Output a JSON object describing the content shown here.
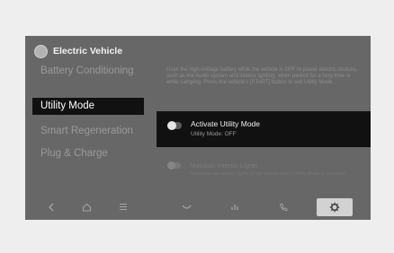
{
  "header": {
    "title": "Electric Vehicle"
  },
  "menu": {
    "items": [
      {
        "label": "Battery Conditioning"
      },
      {
        "label": "Utility Mode"
      },
      {
        "label": "Smart Regeneration"
      },
      {
        "label": "Plug & Charge"
      }
    ]
  },
  "description": "Uses the high-voltage battery while the vehicle is OFF to power electric devices, such as the Audio system and interior lighting, when parked for a long time or while camping. Press the vehicle's [START] button to exit Utility Mode.",
  "utility": {
    "label": "Activate Utility Mode",
    "status": "Utility Mode: OFF",
    "enabled": false
  },
  "secondary": {
    "label": "Maintain Interior Lights",
    "desc": "Maintains the interior lights of the vehicle when Utility Mode is activated.",
    "enabled": false
  },
  "bottom_bar": {
    "icons": [
      "back-icon",
      "home-icon",
      "menu-icon",
      "climate-icon",
      "media-icon",
      "phone-icon",
      "settings-icon"
    ]
  }
}
